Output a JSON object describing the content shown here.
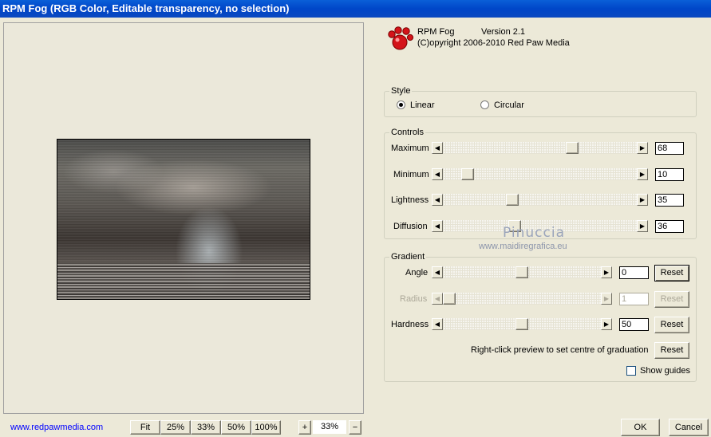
{
  "window": {
    "title": "RPM Fog (RGB Color, Editable transparency, no selection)"
  },
  "about": {
    "name": "RPM Fog",
    "version": "Version 2.1",
    "copyright": "(C)opyright 2006-2010 Red Paw Media",
    "logo": "red-paw-icon"
  },
  "style": {
    "title": "Style",
    "options": [
      "Linear",
      "Circular"
    ],
    "selected": "Linear"
  },
  "controls": {
    "title": "Controls",
    "sliders": [
      {
        "label": "Maximum",
        "value": "68",
        "level": 0.68
      },
      {
        "label": "Minimum",
        "value": "10",
        "level": 0.1
      },
      {
        "label": "Lightness",
        "value": "35",
        "level": 0.35
      },
      {
        "label": "Diffusion",
        "value": "36",
        "level": 0.36
      }
    ]
  },
  "gradient": {
    "title": "Gradient",
    "sliders": [
      {
        "label": "Angle",
        "value": "0",
        "level": 0.5,
        "enabled": true,
        "reset": "Reset"
      },
      {
        "label": "Radius",
        "value": "1",
        "level": 0.0,
        "enabled": false,
        "reset": "Reset"
      },
      {
        "label": "Hardness",
        "value": "50",
        "level": 0.5,
        "enabled": true,
        "reset": "Reset"
      }
    ],
    "hint": "Right-click preview to set centre of graduation",
    "hint_reset": "Reset",
    "show_guides": "Show guides",
    "show_guides_checked": false
  },
  "watermark": {
    "line1": "Pinuccia",
    "line2": "www.maidiregrafica.eu"
  },
  "footer": {
    "link": "www.redpawmedia.com",
    "zoom_buttons": [
      "Fit",
      "25%",
      "33%",
      "50%",
      "100%"
    ],
    "plus": "+",
    "minus": "−",
    "zoom_value": "33%",
    "ok": "OK",
    "cancel": "Cancel"
  }
}
